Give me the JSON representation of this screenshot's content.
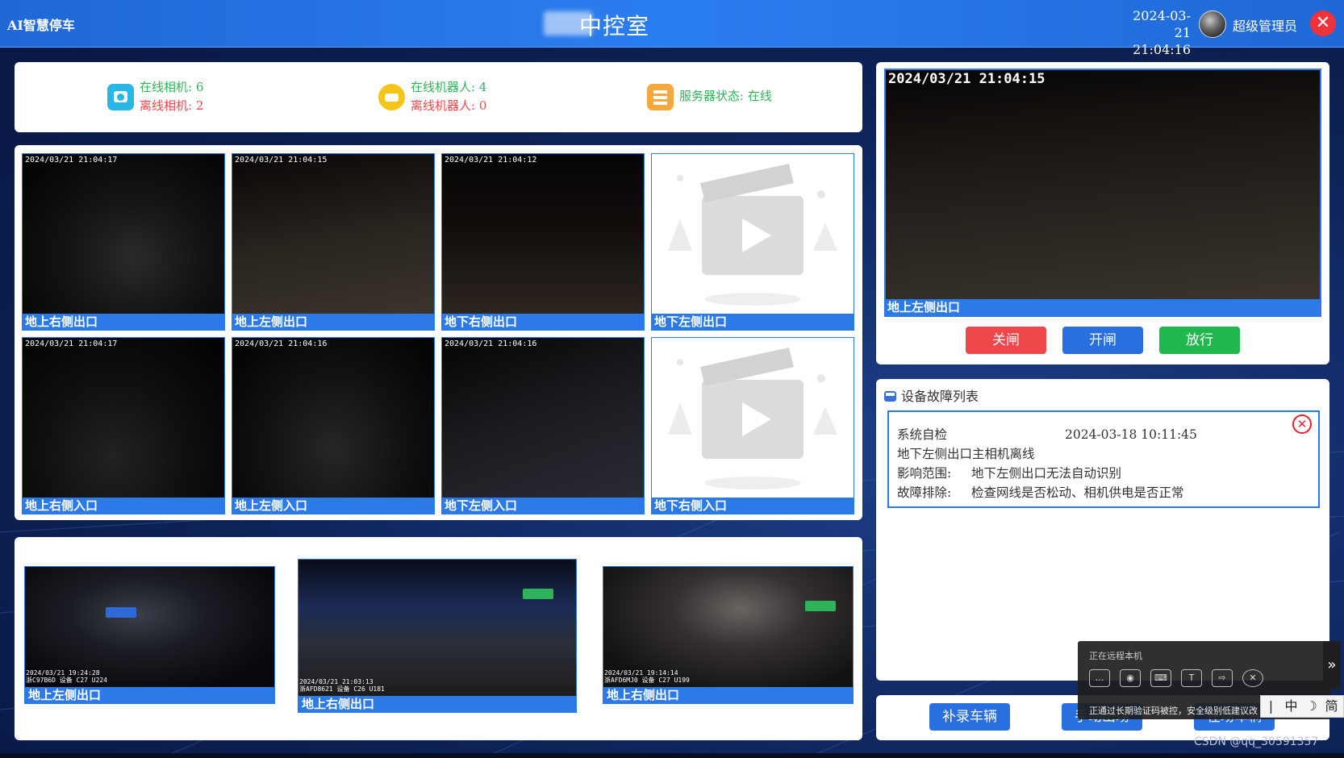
{
  "header": {
    "brand": "AI智慧停车",
    "title": "中控室",
    "date": "2024-03-21",
    "time": "21:04:16",
    "user": "超级管理员",
    "close_glyph": "✕"
  },
  "status": {
    "online_cameras": "在线相机: 6",
    "offline_cameras": "离线相机: 2",
    "online_robots": "在线机器人: 4",
    "offline_robots": "离线机器人: 0",
    "server_status": "服务器状态: 在线"
  },
  "cameras": [
    {
      "timestamp": "2024/03/21 21:04:17",
      "label": "地上右侧出口"
    },
    {
      "timestamp": "2024/03/21 21:04:15",
      "label": "地上左侧出口"
    },
    {
      "timestamp": "2024/03/21 21:04:12",
      "label": "地下右侧出口"
    },
    {
      "timestamp": "",
      "label": "地下左侧出口"
    },
    {
      "timestamp": "2024/03/21 21:04:17",
      "label": "地上右侧入口"
    },
    {
      "timestamp": "2024/03/21 21:04:16",
      "label": "地上左侧入口"
    },
    {
      "timestamp": "2024/03/21 21:04:16",
      "label": "地下左侧入口"
    },
    {
      "timestamp": "",
      "label": "地下右侧入口"
    }
  ],
  "captures": [
    {
      "label": "地上左侧出口",
      "stamp1": "2024/03/21 19:24:28",
      "stamp2": "浙C97B6D 设备 C27 U224"
    },
    {
      "label": "地上右侧出口",
      "stamp1": "2024/03/21 21:03:13",
      "stamp2": "浙AFD8621 设备 C26 U181"
    },
    {
      "label": "地上右侧出口",
      "stamp1": "2024/03/21 19:14:14",
      "stamp2": "浙AFD6MJ0 设备 C27 U199"
    }
  ],
  "main_view": {
    "timestamp": "2024/03/21 21:04:15",
    "label": "地上左侧出口",
    "buttons": {
      "close": "关闸",
      "open": "开闸",
      "release": "放行"
    }
  },
  "colors": {
    "close": "#f0474c",
    "open": "#2a6fe0",
    "release": "#1fb74e"
  },
  "faults": {
    "title": "设备故障列表",
    "items": [
      {
        "type": "系统自检",
        "time": "2024-03-18 10:11:45",
        "desc": "地下左侧出口主相机离线",
        "scope_key": "影响范围:",
        "scope": "地下左侧出口无法自动识别",
        "fix_key": "故障排除:",
        "fix": "检查网线是否松动、相机供电是否正常"
      }
    ]
  },
  "actions": {
    "add_vehicle": "补录车辆",
    "manual_exit": "手动出场",
    "on_site": "在场车辆"
  },
  "remote": {
    "title": "正在远程本机",
    "notice": "正通过长期验证码被控，安全级别低建议改",
    "tools": [
      "chat-icon",
      "mic-icon",
      "keyboard-icon",
      "text-icon",
      "file-icon",
      "close-icon"
    ],
    "expand": "»"
  },
  "ime": {
    "keys": [
      "|",
      "中",
      "☽",
      "简"
    ]
  },
  "watermark": "CSDN @qq_30591357"
}
